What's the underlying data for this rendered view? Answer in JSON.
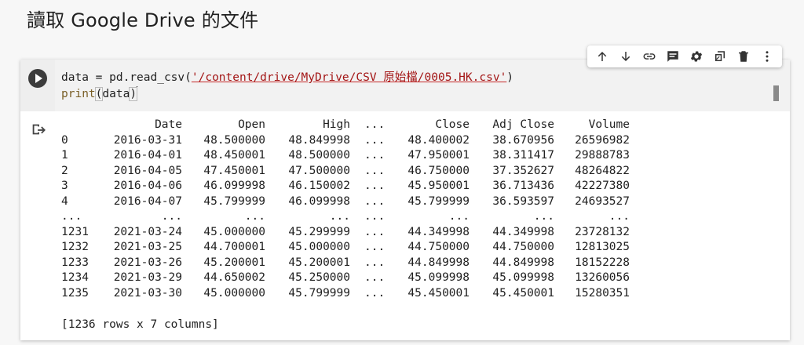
{
  "heading": "讀取 Google Drive 的文件",
  "code": {
    "line1_prefix": "data = pd.read_csv(",
    "line1_string": "'/content/drive/MyDrive/CSV 原始檔/0005.HK.csv'",
    "line1_suffix": ")",
    "line2_fn": "print",
    "line2_open": "(",
    "line2_arg": "data",
    "line2_close": ")"
  },
  "toolbar": {
    "icons": [
      "arrow-up-icon",
      "arrow-down-icon",
      "link-icon",
      "comment-icon",
      "gear-icon",
      "mirror-cell-icon",
      "delete-icon",
      "more-vert-icon"
    ]
  },
  "output": {
    "header": {
      "idx": "",
      "date": "Date",
      "open": "Open",
      "high": "High",
      "ellipsis": "...",
      "close": "Close",
      "adj": "Adj Close",
      "volume": "Volume"
    },
    "rows": [
      {
        "idx": "0",
        "date": "2016-03-31",
        "open": "48.500000",
        "high": "48.849998",
        "ellipsis": "...",
        "close": "48.400002",
        "adj": "38.670956",
        "volume": "26596982"
      },
      {
        "idx": "1",
        "date": "2016-04-01",
        "open": "48.450001",
        "high": "48.500000",
        "ellipsis": "...",
        "close": "47.950001",
        "adj": "38.311417",
        "volume": "29888783"
      },
      {
        "idx": "2",
        "date": "2016-04-05",
        "open": "47.450001",
        "high": "47.500000",
        "ellipsis": "...",
        "close": "46.750000",
        "adj": "37.352627",
        "volume": "48264822"
      },
      {
        "idx": "3",
        "date": "2016-04-06",
        "open": "46.099998",
        "high": "46.150002",
        "ellipsis": "...",
        "close": "45.950001",
        "adj": "36.713436",
        "volume": "42227380"
      },
      {
        "idx": "4",
        "date": "2016-04-07",
        "open": "45.799999",
        "high": "46.099998",
        "ellipsis": "...",
        "close": "45.799999",
        "adj": "36.593597",
        "volume": "24693527"
      },
      {
        "idx": "...",
        "date": "...",
        "open": "...",
        "high": "...",
        "ellipsis": "...",
        "close": "...",
        "adj": "...",
        "volume": "..."
      },
      {
        "idx": "1231",
        "date": "2021-03-24",
        "open": "45.000000",
        "high": "45.299999",
        "ellipsis": "...",
        "close": "44.349998",
        "adj": "44.349998",
        "volume": "23728132"
      },
      {
        "idx": "1232",
        "date": "2021-03-25",
        "open": "44.700001",
        "high": "45.000000",
        "ellipsis": "...",
        "close": "44.750000",
        "adj": "44.750000",
        "volume": "12813025"
      },
      {
        "idx": "1233",
        "date": "2021-03-26",
        "open": "45.200001",
        "high": "45.200001",
        "ellipsis": "...",
        "close": "44.849998",
        "adj": "44.849998",
        "volume": "18152228"
      },
      {
        "idx": "1234",
        "date": "2021-03-29",
        "open": "44.650002",
        "high": "45.250000",
        "ellipsis": "...",
        "close": "45.099998",
        "adj": "45.099998",
        "volume": "13260056"
      },
      {
        "idx": "1235",
        "date": "2021-03-30",
        "open": "45.000000",
        "high": "45.799999",
        "ellipsis": "...",
        "close": "45.450001",
        "adj": "45.450001",
        "volume": "15280351"
      }
    ],
    "summary": "[1236 rows x 7 columns]"
  }
}
